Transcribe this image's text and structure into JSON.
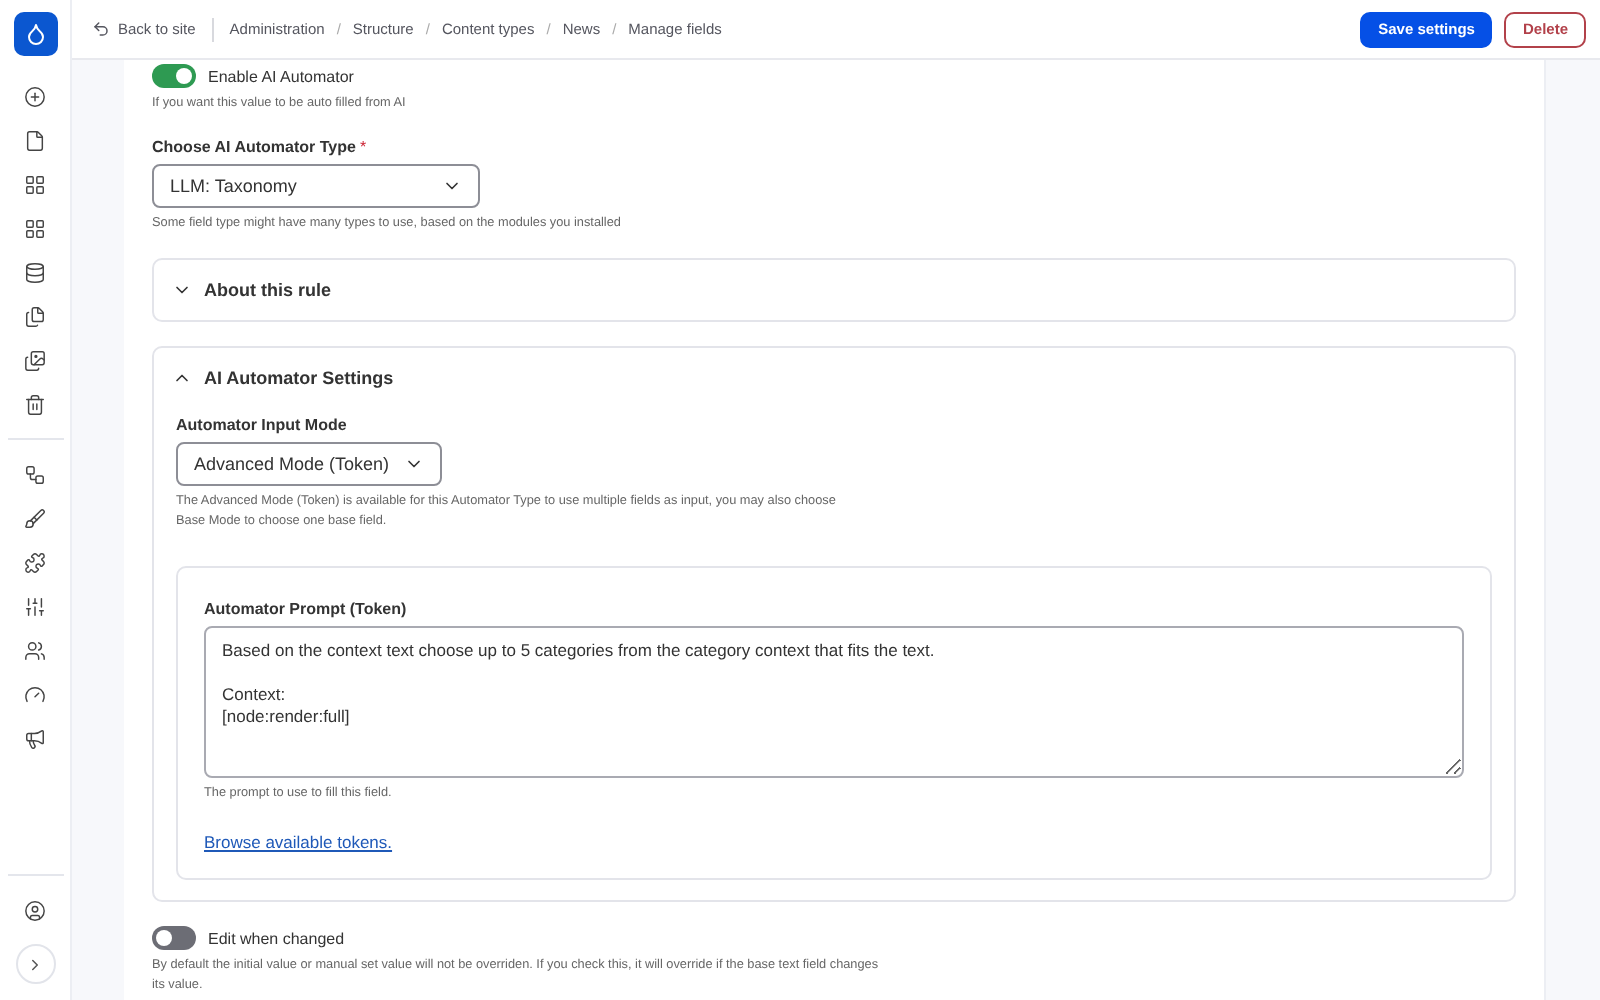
{
  "breadcrumb": {
    "back": "Back to site",
    "separator": "/",
    "items": [
      "Administration",
      "Structure",
      "Content types",
      "News",
      "Manage fields"
    ]
  },
  "actions": [
    {
      "label": "Save settings",
      "kind": "primary"
    },
    {
      "label": "Delete",
      "kind": "danger"
    }
  ],
  "enable_toggle": {
    "label": "Enable AI Automator",
    "on": true,
    "hint": "If you want this value to be auto filled from AI"
  },
  "type_field": {
    "label": "Choose AI Automator Type",
    "required_mark": "*",
    "value": "LLM: Taxonomy",
    "hint": "Some field type might have many types to use, based on the modules you installed"
  },
  "sections": [
    {
      "title": "About this rule",
      "expanded": false
    },
    {
      "title": "AI Automator Settings",
      "expanded": true
    }
  ],
  "input_mode": {
    "label": "Automator Input Mode",
    "value": "Advanced Mode (Token)",
    "hint": "The Advanced Mode (Token) is available for this Automator Type to use multiple fields as input, you may also choose Base Mode to choose one base field."
  },
  "prompt": {
    "label": "Automator Prompt (Token)",
    "value": "Based on the context text choose up to 5 categories from the category context that fits the text.\n\nContext:\n[node:render:full]",
    "hint": "The prompt to use to fill this field.",
    "link": "Browse available tokens."
  },
  "edit_toggle": {
    "label": "Edit when changed",
    "on": false,
    "hint": "By default the initial value or manual set value will not be overriden. If you check this, it will override if the base text field changes its value."
  }
}
